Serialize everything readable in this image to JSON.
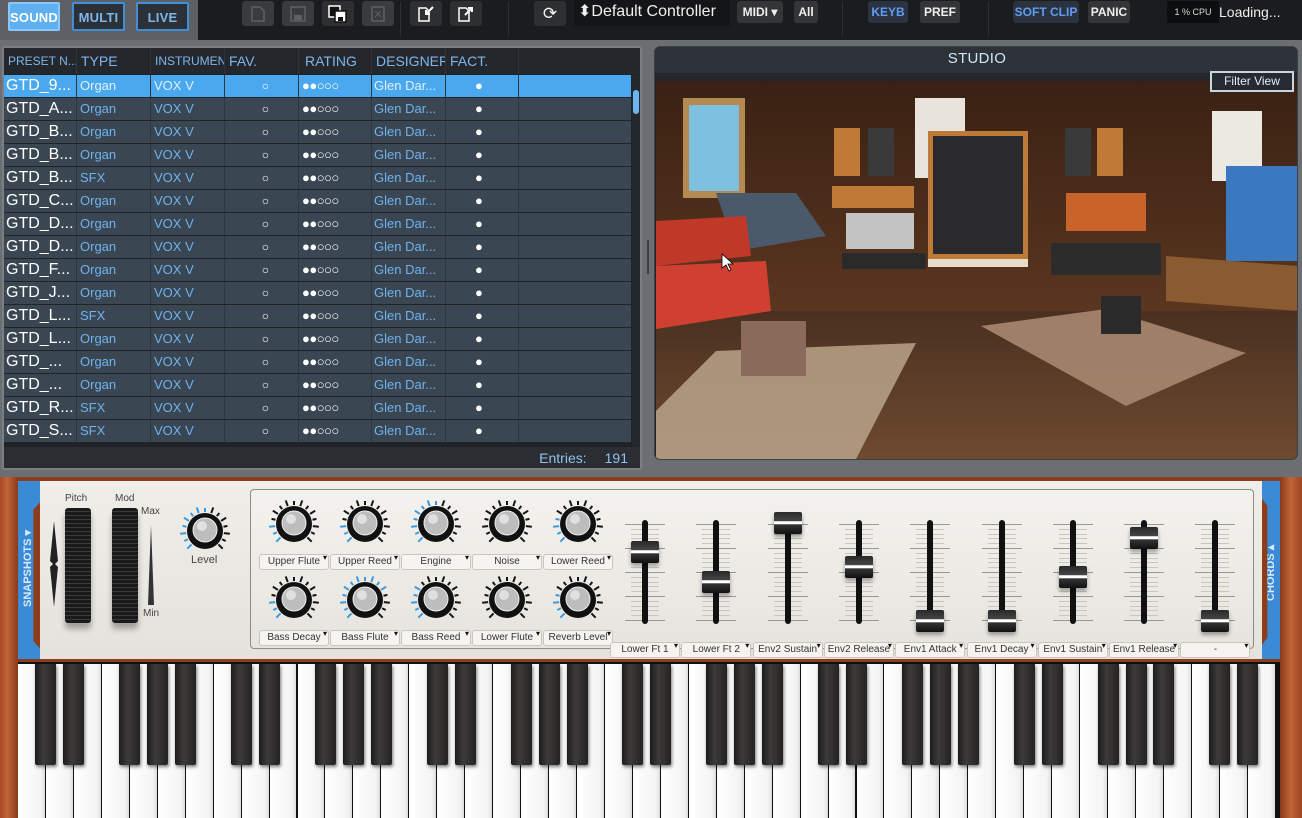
{
  "toolbar": {
    "modes": [
      {
        "label": "SOUND",
        "active": true
      },
      {
        "label": "MULTI",
        "active": false
      },
      {
        "label": "LIVE",
        "active": false
      }
    ],
    "file_buttons": [
      {
        "icon": "new-preset-icon",
        "enabled": false
      },
      {
        "icon": "save-icon",
        "enabled": false
      },
      {
        "icon": "save-as-icon",
        "enabled": true
      },
      {
        "icon": "delete-icon",
        "enabled": false
      },
      {
        "icon": "import-icon",
        "enabled": true
      },
      {
        "icon": "export-icon",
        "enabled": true
      }
    ],
    "refresh_icon": "refresh-icon",
    "controller_arrow": "⬍",
    "controller_name": "Default Controller",
    "midi_label": "MIDI ▾",
    "midi_channel": "All",
    "keyb_label": "KEYB",
    "pref_label": "PREF",
    "soft_clip_label": "SOFT CLIP",
    "panic_label": "PANIC",
    "cpu": "1 % CPU",
    "status": "Loading..."
  },
  "browser": {
    "columns": [
      "PRESET N...",
      "TYPE",
      "INSTRUMENT",
      "FAV.",
      "RATING",
      "DESIGNER",
      "FACT."
    ],
    "rows": [
      {
        "name": "GTD_9...",
        "type": "Organ",
        "instrument": "VOX V",
        "fav": "○",
        "rating": "●●○○○",
        "designer": "Glen Dar...",
        "factory": "●",
        "selected": true
      },
      {
        "name": "GTD_A...",
        "type": "Organ",
        "instrument": "VOX V",
        "fav": "○",
        "rating": "●●○○○",
        "designer": "Glen Dar...",
        "factory": "●"
      },
      {
        "name": "GTD_B...",
        "type": "Organ",
        "instrument": "VOX V",
        "fav": "○",
        "rating": "●●○○○",
        "designer": "Glen Dar...",
        "factory": "●"
      },
      {
        "name": "GTD_B...",
        "type": "Organ",
        "instrument": "VOX V",
        "fav": "○",
        "rating": "●●○○○",
        "designer": "Glen Dar...",
        "factory": "●"
      },
      {
        "name": "GTD_B...",
        "type": "SFX",
        "instrument": "VOX V",
        "fav": "○",
        "rating": "●●○○○",
        "designer": "Glen Dar...",
        "factory": "●"
      },
      {
        "name": "GTD_C...",
        "type": "Organ",
        "instrument": "VOX V",
        "fav": "○",
        "rating": "●●○○○",
        "designer": "Glen Dar...",
        "factory": "●"
      },
      {
        "name": "GTD_D...",
        "type": "Organ",
        "instrument": "VOX V",
        "fav": "○",
        "rating": "●●○○○",
        "designer": "Glen Dar...",
        "factory": "●"
      },
      {
        "name": "GTD_D...",
        "type": "Organ",
        "instrument": "VOX V",
        "fav": "○",
        "rating": "●●○○○",
        "designer": "Glen Dar...",
        "factory": "●"
      },
      {
        "name": "GTD_F...",
        "type": "Organ",
        "instrument": "VOX V",
        "fav": "○",
        "rating": "●●○○○",
        "designer": "Glen Dar...",
        "factory": "●"
      },
      {
        "name": "GTD_J...",
        "type": "Organ",
        "instrument": "VOX V",
        "fav": "○",
        "rating": "●●○○○",
        "designer": "Glen Dar...",
        "factory": "●"
      },
      {
        "name": "GTD_L...",
        "type": "SFX",
        "instrument": "VOX V",
        "fav": "○",
        "rating": "●●○○○",
        "designer": "Glen Dar...",
        "factory": "●"
      },
      {
        "name": "GTD_L...",
        "type": "Organ",
        "instrument": "VOX V",
        "fav": "○",
        "rating": "●●○○○",
        "designer": "Glen Dar...",
        "factory": "●"
      },
      {
        "name": "GTD_...",
        "type": "Organ",
        "instrument": "VOX V",
        "fav": "○",
        "rating": "●●○○○",
        "designer": "Glen Dar...",
        "factory": "●"
      },
      {
        "name": "GTD_...",
        "type": "Organ",
        "instrument": "VOX V",
        "fav": "○",
        "rating": "●●○○○",
        "designer": "Glen Dar...",
        "factory": "●"
      },
      {
        "name": "GTD_R...",
        "type": "SFX",
        "instrument": "VOX V",
        "fav": "○",
        "rating": "●●○○○",
        "designer": "Glen Dar...",
        "factory": "●"
      },
      {
        "name": "GTD_S...",
        "type": "SFX",
        "instrument": "VOX V",
        "fav": "○",
        "rating": "●●○○○",
        "designer": "Glen Dar...",
        "factory": "●"
      }
    ],
    "entries_label": "Entries:",
    "entries_count": "191",
    "scroll_position": 0.03
  },
  "studio": {
    "title": "STUDIO",
    "filter_view_label": "Filter View",
    "image_description": "3D studio room with vintage keyboards and synthesizers"
  },
  "instrument": {
    "snapshots_label": "SNAPSHOTS ▾",
    "chords_label": "CHORDS ▴",
    "pitch_label": "Pitch",
    "mod_label": "Mod",
    "mod_max": "Max",
    "mod_min": "Min",
    "level_label": "Level",
    "level_value": 0.55,
    "knobs_top": [
      {
        "label": "Upper Flute",
        "value": 0.2
      },
      {
        "label": "Upper Reed",
        "value": 0.15
      },
      {
        "label": "Engine",
        "value": 0.55
      },
      {
        "label": "Noise",
        "value": 0.0
      },
      {
        "label": "Lower Reed",
        "value": 0.25
      }
    ],
    "knobs_bottom": [
      {
        "label": "Bass Decay",
        "value": 0.2
      },
      {
        "label": "Bass Flute",
        "value": 0.75
      },
      {
        "label": "Bass Reed",
        "value": 0.35
      },
      {
        "label": "Lower Flute",
        "value": 0.0
      },
      {
        "label": "Reverb Level",
        "value": 0.25
      }
    ],
    "sliders": [
      {
        "label": "Lower Ft 1",
        "value": 0.7
      },
      {
        "label": "Lower Ft 2",
        "value": 0.4
      },
      {
        "label": "Env2 Sustain",
        "value": 1.0
      },
      {
        "label": "Env2 Release",
        "value": 0.55
      },
      {
        "label": "Env1 Attack",
        "value": 0.0
      },
      {
        "label": "Env1 Decay",
        "value": 0.0
      },
      {
        "label": "Env1 Sustain",
        "value": 0.45
      },
      {
        "label": "Env1 Release",
        "value": 0.85
      },
      {
        "label": "-",
        "value": 0.0
      }
    ]
  },
  "colors": {
    "accent": "#4aa8ee",
    "row_bg": "#3a4652",
    "text_blue": "#6fb2ee",
    "panel_bg": "#efeee9",
    "wood": "#b0532a"
  }
}
